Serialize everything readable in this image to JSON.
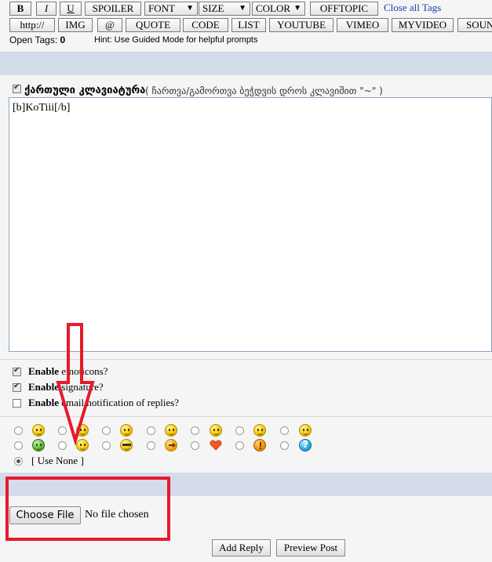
{
  "toolbar_row1": {
    "bold": "B",
    "italic": "I",
    "underline": "U",
    "spoiler": "SPOILER",
    "font": "FONT",
    "size": "SIZE",
    "color": "COLOR",
    "offtopic": "OFFTOPIC",
    "close_all": "Close all Tags"
  },
  "toolbar_row2": {
    "http": "http://",
    "img": "IMG",
    "at": "@",
    "quote": "QUOTE",
    "code": "CODE",
    "list": "LIST",
    "youtube": "YOUTUBE",
    "vimeo": "VIMEO",
    "myvideo": "MYVIDEO",
    "sound": "SOUN"
  },
  "status": {
    "open_tags_label": "Open Tags:",
    "open_tags_count": "0",
    "hint": "Hint: Use Guided Mode for helpful prompts"
  },
  "keyboard": {
    "label": "ქართული კლავიატურა",
    "hint": "( ჩართვა/გამორთვა ბეჭდვის დროს კლავიშით \"~\" )",
    "checked": true
  },
  "editor": {
    "value": "[b]KoTiii[/b]"
  },
  "options": {
    "emoticons_bold": "Enable",
    "emoticons_rest": " emoticons?",
    "signature_bold": "Enable",
    "signature_rest": " signature?",
    "email_bold": "Enable",
    "email_rest": " email notification of replies?"
  },
  "emoticons": {
    "use_none": "[ Use None ]"
  },
  "attachment": {
    "choose_file": "Choose File",
    "no_file": "No file chosen"
  },
  "actions": {
    "add_reply": "Add Reply",
    "preview_post": "Preview Post"
  },
  "colors": {
    "band": "#d3dce8",
    "link": "#1a3fa8",
    "annotation_red": "#e8192c"
  }
}
